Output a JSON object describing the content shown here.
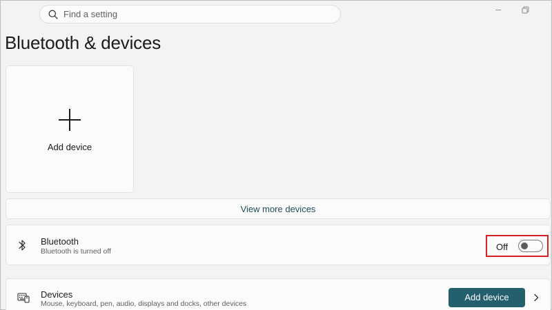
{
  "search": {
    "placeholder": "Find a setting",
    "icon": "search-icon"
  },
  "window_controls": {
    "minimize_icon": "minimize-icon",
    "restore_icon": "restore-icon"
  },
  "page": {
    "title": "Bluetooth & devices"
  },
  "add_device_tile": {
    "label": "Add device",
    "icon": "plus-icon"
  },
  "view_more": {
    "label": "View more devices"
  },
  "bluetooth": {
    "title": "Bluetooth",
    "subtitle": "Bluetooth is turned off",
    "toggle_state": "Off",
    "toggle_on": false,
    "icon": "bluetooth-icon"
  },
  "devices": {
    "title": "Devices",
    "subtitle": "Mouse, keyboard, pen, audio, displays and docks, other devices",
    "add_button_label": "Add device",
    "icon": "keyboard-icon"
  },
  "colors": {
    "accent": "#235f6d",
    "link": "#1f4b5a",
    "highlight": "#d61f26",
    "background": "#f3f3f3",
    "card": "#fbfbfb"
  }
}
